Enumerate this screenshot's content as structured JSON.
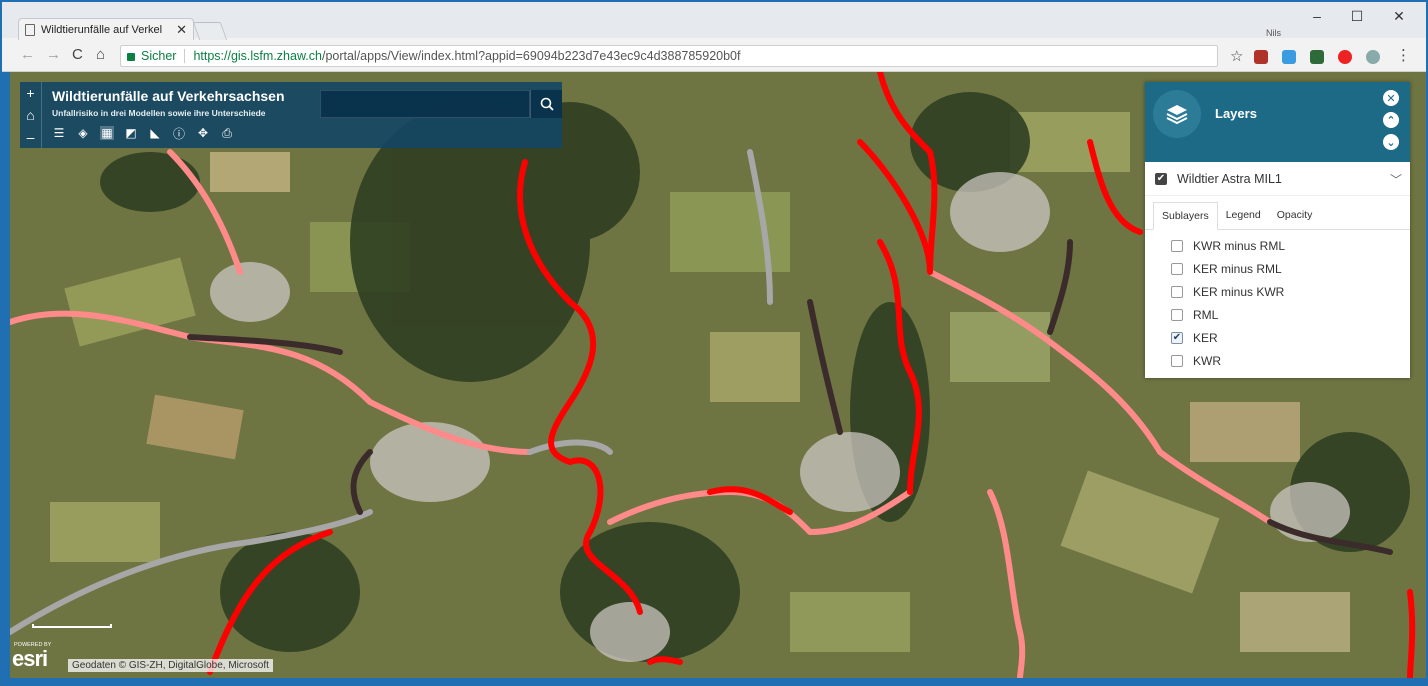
{
  "browser": {
    "tab_title": "Wildtierunfälle auf Verkel",
    "profile_name": "Nils",
    "secure_label": "Sicher",
    "url_host": "https://gis.lsfm.zhaw.ch",
    "url_rest": "/portal/apps/View/index.html?appid=69094b223d7e43ec9c4d388785920b0f",
    "nav_back": "←",
    "nav_forward": "→",
    "nav_reload": "C",
    "nav_home": "⌂",
    "win_min": "–",
    "win_max": "☐",
    "win_close": "✕",
    "tab_close": "✕",
    "star": "☆",
    "menu": "⋮"
  },
  "app": {
    "title": "Wildtierunfälle auf Verkehrsachsen",
    "subtitle": "Unfallrisiko in drei Modellen sowie ihre Unterschiede",
    "zoom_in": "+",
    "home": "⌂",
    "zoom_out": "–",
    "tools": [
      "list-icon",
      "layers-icon",
      "basemap-icon",
      "overview-icon",
      "measure-icon",
      "info-icon",
      "locate-icon",
      "print-icon"
    ]
  },
  "layers_panel": {
    "title": "Layers",
    "close": "✕",
    "up": "⌃",
    "down": "⌄",
    "layer_name": "Wildtier Astra MIL1",
    "layer_checked": true,
    "tabs": [
      "Sublayers",
      "Legend",
      "Opacity"
    ],
    "selected_tab": "Sublayers",
    "sublayers": [
      {
        "label": "KWR minus RML",
        "checked": false
      },
      {
        "label": "KER minus RML",
        "checked": false
      },
      {
        "label": "KER minus KWR",
        "checked": false
      },
      {
        "label": "RML",
        "checked": false
      },
      {
        "label": "KER",
        "checked": true
      },
      {
        "label": "KWR",
        "checked": false
      }
    ]
  },
  "map": {
    "powered_by": "POWERED BY",
    "esri_logo": "esri",
    "attribution": "Geodaten © GIS-ZH, DigitalGlobe, Microsoft",
    "colors": {
      "red": "#ff0000",
      "pink": "#ff8a8a",
      "dark": "#3b2b2b",
      "grey": "#a7a7a7"
    }
  }
}
